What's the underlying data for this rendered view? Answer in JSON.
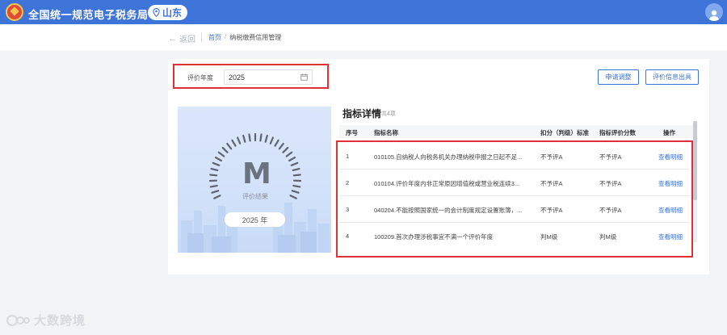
{
  "header": {
    "app_title": "全国统一规范电子税务局",
    "region": "山东"
  },
  "nav": {
    "back_label": "返回",
    "breadcrumb": [
      "首页",
      "纳税缴费信用管理"
    ]
  },
  "filter": {
    "year_label": "评价年度",
    "year_value": "2025"
  },
  "actions": {
    "apply_adjust": "申请调整",
    "issue_info": "评价信息出具"
  },
  "result": {
    "grade": "M",
    "caption": "评价结果",
    "year": "2025 年"
  },
  "indicators": {
    "title": "指标详情",
    "count_text": "共4项",
    "columns": [
      "序号",
      "指标名称",
      "扣分（判级）标准",
      "指标评价分数",
      "操作"
    ],
    "rows": [
      {
        "no": "1",
        "name": "010105.自纳税人向税务机关办理纳税申报之日起不足...",
        "standard": "不予评A",
        "score": "不予评A",
        "action": "查看明细"
      },
      {
        "no": "2",
        "name": "010104.评价年度内非正常原因增值税或营业税连续3...",
        "standard": "不予评A",
        "score": "不予评A",
        "action": "查看明细"
      },
      {
        "no": "3",
        "name": "040204.不能按照国家统一的会计制度规定设置账簿，...",
        "standard": "不予评A",
        "score": "不予评A",
        "action": "查看明细"
      },
      {
        "no": "4",
        "name": "100209.首次办理涉税事宜不满一个评价年度",
        "standard": "判M级",
        "score": "判M级",
        "action": "查看明细"
      }
    ]
  },
  "watermark": {
    "text": "大数跨境"
  }
}
